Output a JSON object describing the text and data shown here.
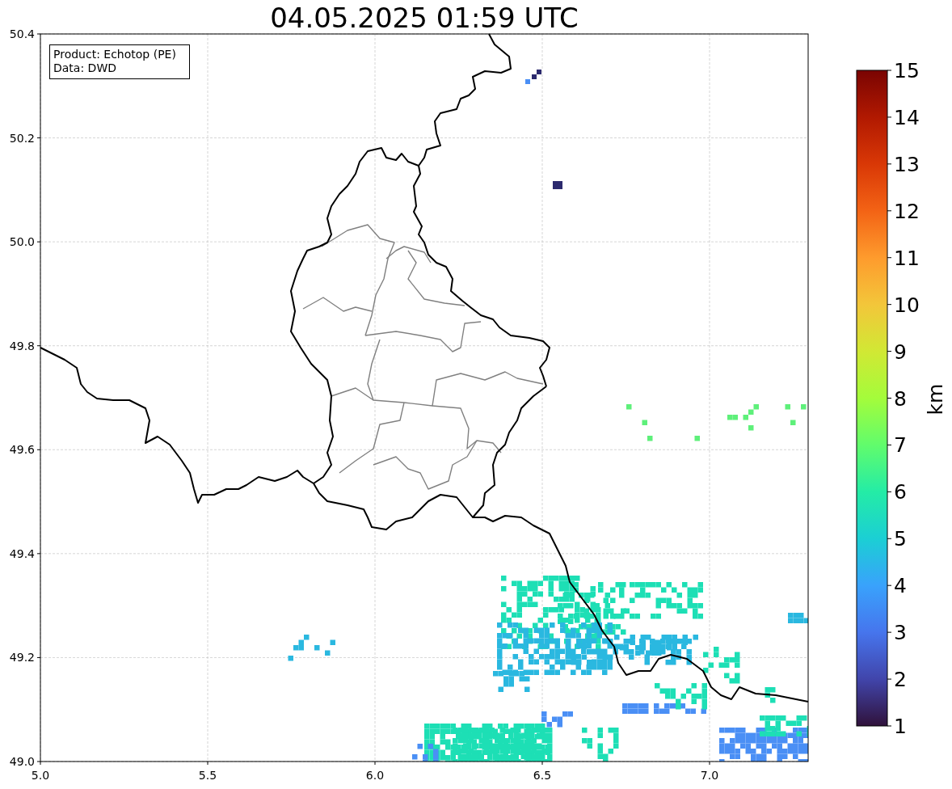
{
  "title": "04.05.2025 01:59 UTC",
  "info_box": [
    "Product: Echotop (PE)",
    "Data: DWD"
  ],
  "x_ticks": [
    "5.0",
    "5.5",
    "6.0",
    "6.5",
    "7.0"
  ],
  "y_ticks": [
    "50.4",
    "50.2",
    "50.0",
    "49.8",
    "49.6",
    "49.4",
    "49.2",
    "49.0"
  ],
  "colorbar": {
    "label": "km",
    "ticks": [
      "15",
      "14",
      "13",
      "12",
      "11",
      "10",
      "9",
      "8",
      "7",
      "6",
      "5",
      "4",
      "3",
      "2",
      "1"
    ]
  }
}
